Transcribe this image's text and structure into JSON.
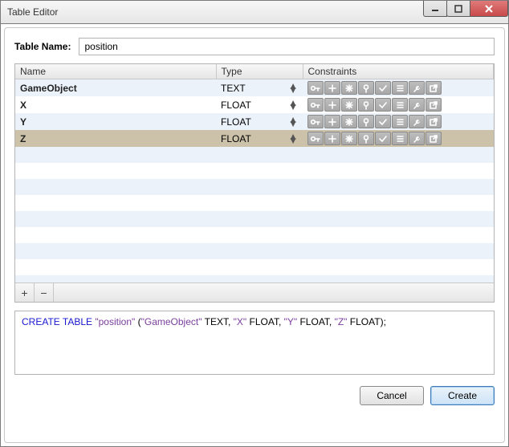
{
  "window": {
    "title": "Table Editor"
  },
  "form": {
    "table_name_label": "Table Name:",
    "table_name_value": "position"
  },
  "grid": {
    "headers": {
      "name": "Name",
      "type": "Type",
      "constraints": "Constraints"
    },
    "rows": [
      {
        "name": "GameObject",
        "type": "TEXT"
      },
      {
        "name": "X",
        "type": "FLOAT"
      },
      {
        "name": "Y",
        "type": "FLOAT"
      },
      {
        "name": "Z",
        "type": "FLOAT"
      }
    ],
    "selected_index": 3,
    "blank_row_count": 9,
    "add_label": "+",
    "remove_label": "−",
    "constraint_icons": [
      "key",
      "plus",
      "asterisk",
      "pin",
      "check",
      "list",
      "wrench",
      "external"
    ]
  },
  "sql": {
    "kw_create": "CREATE TABLE",
    "tbl": "\"position\"",
    "open": " (",
    "c1": "\"GameObject\"",
    "t1": " TEXT, ",
    "c2": "\"X\"",
    "t2": " FLOAT, ",
    "c3": "\"Y\"",
    "t3": " FLOAT, ",
    "c4": "\"Z\"",
    "t4": " FLOAT);"
  },
  "buttons": {
    "cancel": "Cancel",
    "create": "Create"
  }
}
